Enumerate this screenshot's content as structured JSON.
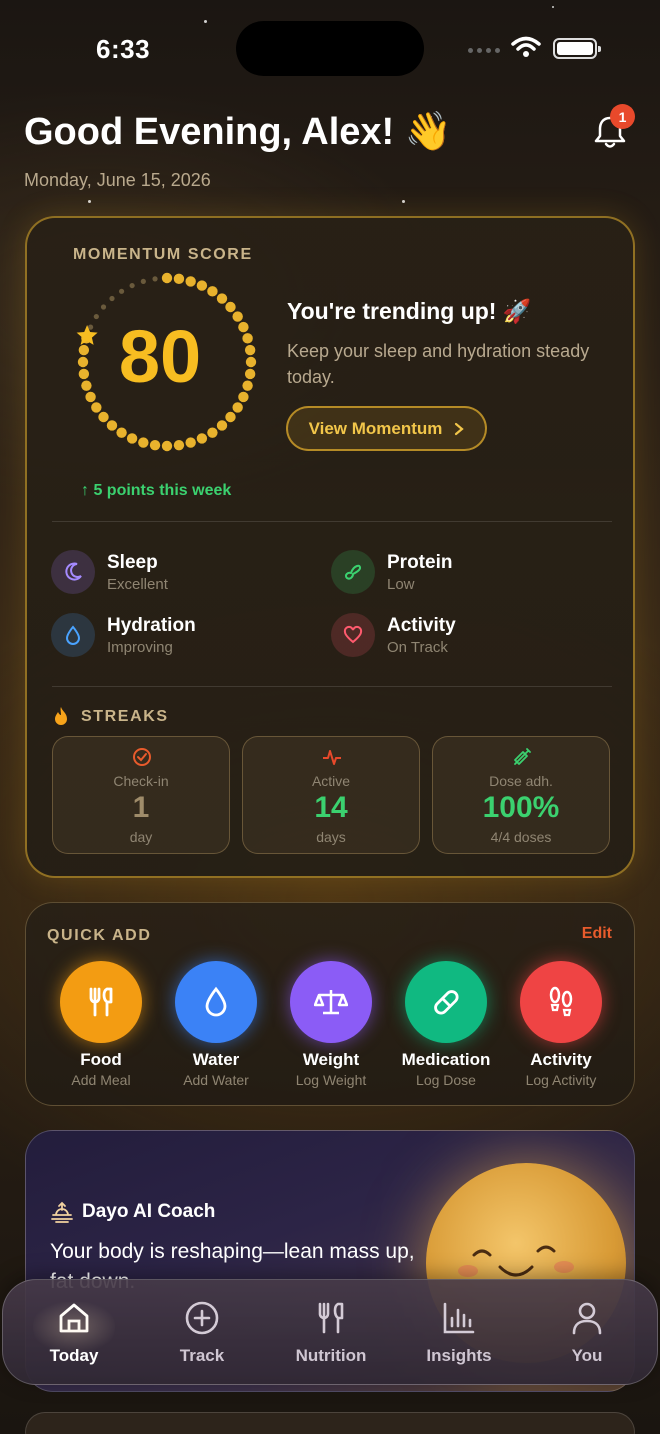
{
  "status_bar": {
    "time": "6:33"
  },
  "header": {
    "greeting": "Good Evening, Alex! 👋",
    "date": "Monday, June 15, 2026",
    "notification_count": "1"
  },
  "momentum": {
    "kicker": "MOMENTUM SCORE",
    "score": "80",
    "score_fraction": 0.8,
    "trend_note": "↑ 5 points this week",
    "trend_title": "You're trending up! 🚀",
    "trend_body": "Keep your sleep and hydration steady today.",
    "view_button": "View Momentum",
    "metrics": [
      {
        "title": "Sleep",
        "status": "Excellent",
        "icon": "moon-icon",
        "color": "#a58bff"
      },
      {
        "title": "Protein",
        "status": "Low",
        "icon": "protein-icon",
        "color": "#3bd16f"
      },
      {
        "title": "Hydration",
        "status": "Improving",
        "icon": "droplet-icon",
        "color": "#4aa3ff"
      },
      {
        "title": "Activity",
        "status": "On Track",
        "icon": "heart-icon",
        "color": "#ff5a6e"
      }
    ],
    "streaks_label": "STREAKS",
    "streaks": [
      {
        "label": "Check-in",
        "value": "1",
        "unit": "day",
        "color": "#9f8c6a",
        "accent": "#e85b2c"
      },
      {
        "label": "Active",
        "value": "14",
        "unit": "days",
        "color": "#3bd16f",
        "accent": "#e8492b"
      },
      {
        "label": "Dose adh.",
        "value": "100%",
        "unit": "4/4 doses",
        "color": "#3bd16f",
        "accent": "#3bd16f"
      }
    ]
  },
  "quick_add": {
    "kicker": "QUICK ADD",
    "edit": "Edit",
    "items": [
      {
        "title": "Food",
        "sub": "Add Meal",
        "color": "#f39c12",
        "icon": "fork-knife-icon"
      },
      {
        "title": "Water",
        "sub": "Add Water",
        "color": "#3b82f6",
        "icon": "water-drop-icon"
      },
      {
        "title": "Weight",
        "sub": "Log Weight",
        "color": "#8b5cf6",
        "icon": "scale-icon"
      },
      {
        "title": "Medication",
        "sub": "Log Dose",
        "color": "#10b981",
        "icon": "pill-icon"
      },
      {
        "title": "Activity",
        "sub": "Log Activity",
        "color": "#ef4444",
        "icon": "footprints-icon"
      }
    ]
  },
  "coach": {
    "title": "Dayo AI Coach",
    "text": "Your body is reshaping—lean mass up, fat down."
  },
  "tabs": [
    {
      "label": "Today",
      "icon": "home-icon",
      "active": true
    },
    {
      "label": "Track",
      "icon": "plus-circle-icon"
    },
    {
      "label": "Nutrition",
      "icon": "fork-knife-icon"
    },
    {
      "label": "Insights",
      "icon": "bar-chart-icon"
    },
    {
      "label": "You",
      "icon": "person-icon"
    }
  ]
}
